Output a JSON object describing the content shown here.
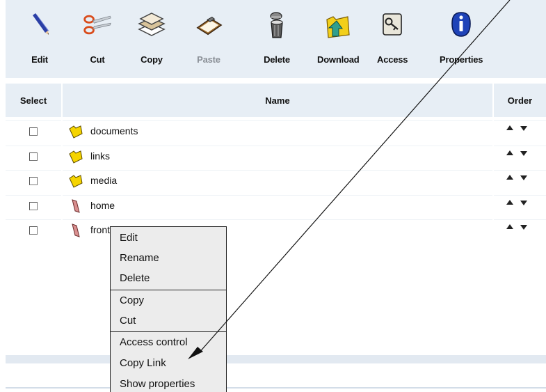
{
  "toolbar": {
    "buttons": [
      {
        "label": "Edit",
        "icon": "pencil-icon"
      },
      {
        "label": "Cut",
        "icon": "scissors-icon"
      },
      {
        "label": "Copy",
        "icon": "copy-pages-icon"
      },
      {
        "label": "Paste",
        "icon": "clipboard-icon",
        "disabled": true
      },
      {
        "label": "Delete",
        "icon": "trash-can-icon"
      },
      {
        "label": "Download",
        "icon": "download-folder-icon"
      },
      {
        "label": "Access",
        "icon": "key-icon"
      },
      {
        "label": "Properties",
        "icon": "info-icon"
      }
    ]
  },
  "table": {
    "headers": {
      "select": "Select",
      "name": "Name",
      "order": "Order"
    },
    "rows": [
      {
        "name": "documents",
        "type": "folder"
      },
      {
        "name": "links",
        "type": "folder"
      },
      {
        "name": "media",
        "type": "folder"
      },
      {
        "name": "home",
        "type": "page"
      },
      {
        "name": "front",
        "type": "page"
      }
    ]
  },
  "context_menu": {
    "groups": [
      [
        "Edit",
        "Rename",
        "Delete"
      ],
      [
        "Copy",
        "Cut"
      ],
      [
        "Access control",
        "Copy Link",
        "Show properties"
      ]
    ]
  },
  "colors": {
    "header_bg": "#e7eef5",
    "folder": "#f5d400",
    "page": "#d98f8f",
    "menu_bg": "#ececec"
  }
}
